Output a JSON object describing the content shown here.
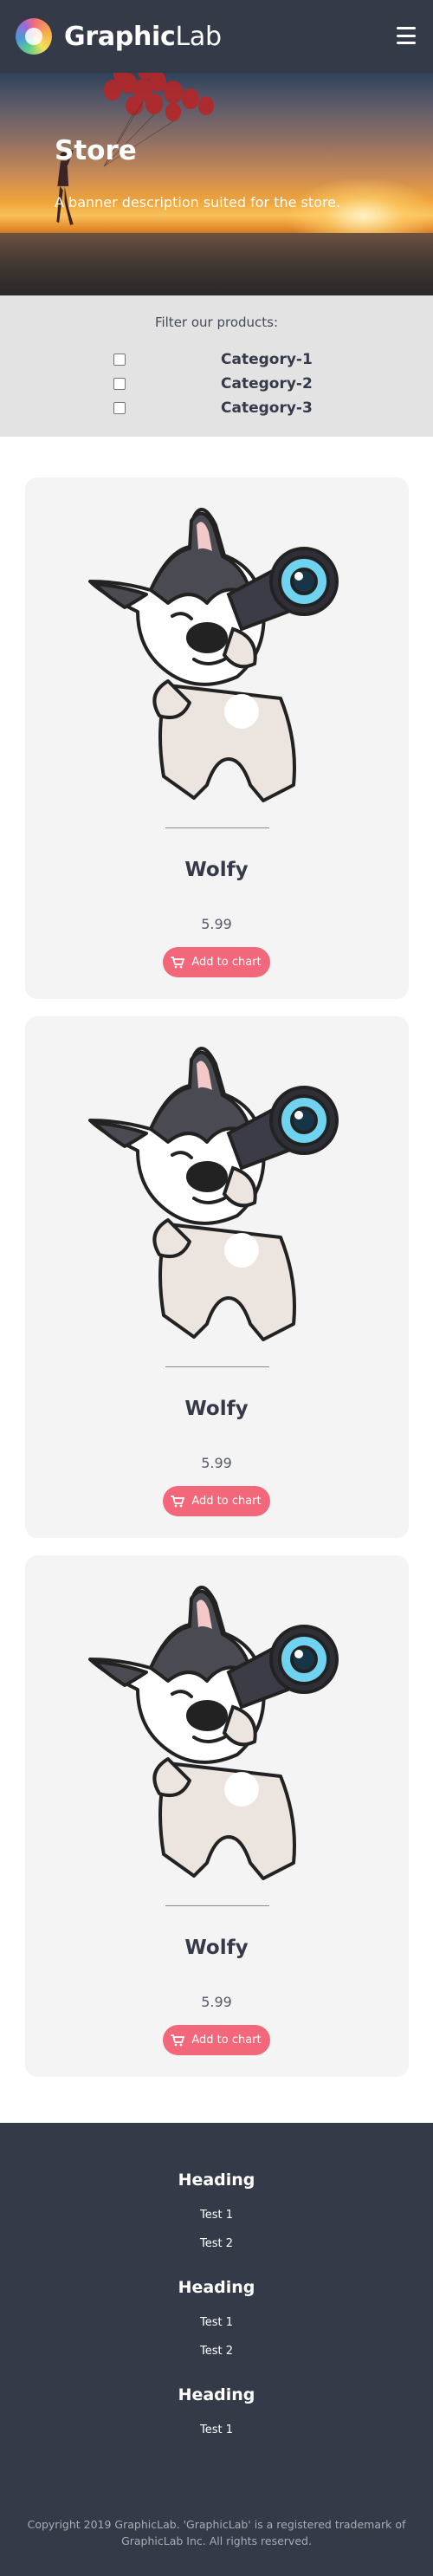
{
  "header": {
    "brand_bold": "Graphic",
    "brand_light": "Lab"
  },
  "banner": {
    "title": "Store",
    "description": "A banner description suited for the store."
  },
  "filter": {
    "label": "Filter our products:",
    "categories": [
      "Category-1",
      "Category-2",
      "Category-3"
    ]
  },
  "products": [
    {
      "name": "Wolfy",
      "price": "5.99",
      "button": "Add to chart"
    },
    {
      "name": "Wolfy",
      "price": "5.99",
      "button": "Add to chart"
    },
    {
      "name": "Wolfy",
      "price": "5.99",
      "button": "Add to chart"
    }
  ],
  "footer": {
    "sections": [
      {
        "heading": "Heading",
        "links": [
          "Test 1",
          "Test 2"
        ]
      },
      {
        "heading": "Heading",
        "links": [
          "Test 1",
          "Test 2"
        ]
      },
      {
        "heading": "Heading",
        "links": [
          "Test 1"
        ]
      }
    ],
    "copyright": "Copyright 2019 GraphicLab. 'GraphicLab' is a registered trademark of GraphicLab Inc. All rights reserved."
  },
  "colors": {
    "header_bg": "#353a48",
    "accent": "#f2687a",
    "card_bg": "#f4f4f4",
    "filter_bg": "#e3e3e3"
  },
  "icons": [
    "logo-icon",
    "hamburger-menu-icon",
    "cart-icon"
  ]
}
